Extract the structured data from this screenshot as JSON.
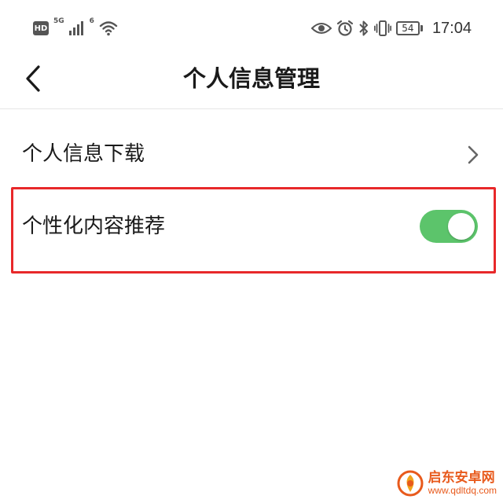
{
  "status_bar": {
    "hd_label": "HD",
    "network_label": "5G",
    "wifi_label": "6",
    "battery_level": "54",
    "time": "17:04",
    "icons": [
      "hd-badge",
      "signal-icon",
      "wifi-icon",
      "eye-icon",
      "alarm-icon",
      "bluetooth-icon",
      "vibrate-icon",
      "battery-icon"
    ]
  },
  "header": {
    "title": "个人信息管理",
    "back_icon": "chevron-left-icon"
  },
  "settings": {
    "items": [
      {
        "label": "个人信息下载",
        "control": "chevron-right-icon"
      },
      {
        "label": "个性化内容推荐",
        "control": "toggle",
        "enabled": true
      }
    ]
  },
  "colors": {
    "toggle_on": "#5cc46b",
    "highlight": "#e8282a",
    "watermark": "#e85a1c"
  },
  "watermark": {
    "name": "启东安卓网",
    "url": "www.qdltdq.com"
  }
}
